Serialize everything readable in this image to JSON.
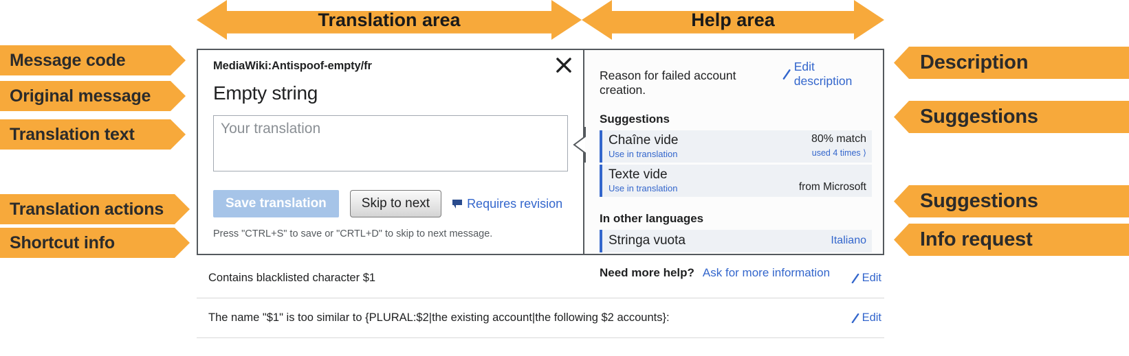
{
  "banners": [
    {
      "label": "Translation area"
    },
    {
      "label": "Help area"
    }
  ],
  "left_callouts": [
    {
      "label": "Message code"
    },
    {
      "label": "Original message"
    },
    {
      "label": "Translation text"
    },
    {
      "label": "Translation actions"
    },
    {
      "label": "Shortcut info"
    }
  ],
  "right_callouts": [
    {
      "label": "Description"
    },
    {
      "label": "Suggestions"
    },
    {
      "label": "Suggestions"
    },
    {
      "label": "Info request"
    }
  ],
  "translation": {
    "message_code": "MediaWiki:Antispoof-empty/fr",
    "original_message": "Empty string",
    "input_placeholder": "Your translation",
    "input_value": "",
    "close_icon": "close-icon",
    "save_label": "Save translation",
    "skip_label": "Skip to next",
    "revision_label": "Requires revision",
    "revision_icon": "flag-icon",
    "shortcut_info": "Press \"CTRL+S\" to save or \"CRTL+D\" to skip to next message."
  },
  "help": {
    "description": "Reason for failed account creation.",
    "edit_description_label": "Edit description",
    "pencil_icon": "pencil-icon",
    "suggestions_heading": "Suggestions",
    "suggestions": [
      {
        "text": "Chaîne vide",
        "action": "Use in translation",
        "match": "80% match",
        "meta": "used 4 times ⟩"
      },
      {
        "text": "Texte vide",
        "action": "Use in translation",
        "match": "",
        "meta": "from Microsoft"
      }
    ],
    "other_languages_heading": "In other languages",
    "other_languages": [
      {
        "text": "Stringa vuota",
        "language": "Italiano"
      }
    ],
    "need_more_help_label": "Need more help?",
    "ask_label": "Ask for more information"
  },
  "message_list": [
    {
      "text": "Contains blacklisted character $1",
      "edit_label": "Edit"
    },
    {
      "text": "The name \"$1\" is too similar to {PLURAL:$2|the existing account|the following $2 accounts}:",
      "edit_label": "Edit"
    }
  ],
  "colors": {
    "callout": "#f7a93b",
    "link": "#3366cc",
    "border": "#54595d",
    "suggestion_bg": "#eef1f5"
  }
}
